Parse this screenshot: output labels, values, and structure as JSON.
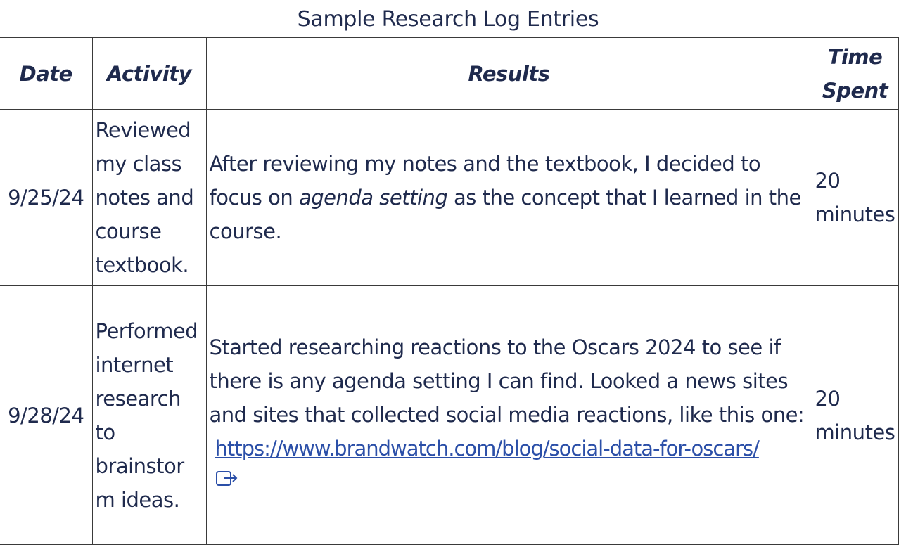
{
  "caption": "Sample Research Log Entries",
  "columns": [
    "Date",
    "Activity",
    "Results",
    "Time Spent"
  ],
  "rows": [
    {
      "date": "9/25/24",
      "activity": "Reviewed my class notes and course textbook.",
      "results_before": "After reviewing my notes and the textbook, I decided to focus on ",
      "results_emphasis": "agenda setting",
      "results_after": " as the concept that I learned in the course.",
      "time": "20 minutes"
    },
    {
      "date": "9/28/24",
      "activity": "Performed internet research to brainstorm ideas.",
      "results_text": "Started researching reactions to the Oscars 2024 to see if there is any agenda setting I can find. Looked a news sites and sites that collected social media reactions, like this one:",
      "results_link": "https://www.brandwatch.com/blog/social-data-for-oscars/",
      "link_icon": "external-link-icon",
      "time": "20 minutes"
    }
  ],
  "colors": {
    "text": "#1f2a4d",
    "link": "#2b4fa8",
    "border": "#3a3a3a"
  }
}
